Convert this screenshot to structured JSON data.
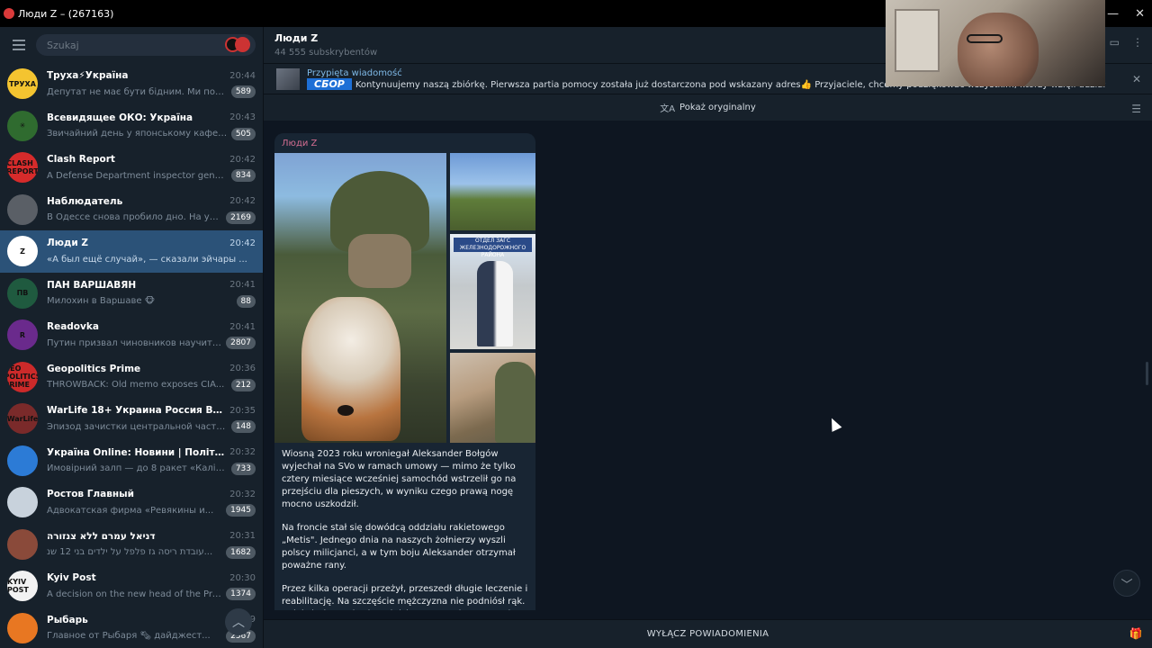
{
  "window": {
    "title": "Люди Z – (267163)"
  },
  "sidebar": {
    "search_placeholder": "Szukaj",
    "chats": [
      {
        "name": "Труха⚡Україна",
        "time": "20:44",
        "preview": "Депутат не має бути бідним. Ми повинн...",
        "badge": "589",
        "avatar_color": "#f4c430",
        "avatar_text": "ТРУХА"
      },
      {
        "name": "Всевидящее ОКО: Україна",
        "time": "20:43",
        "preview": "Звичайний день у японському кафе: пе...",
        "badge": "505",
        "avatar_color": "#2f6b2f",
        "avatar_text": "✳"
      },
      {
        "name": "Clash Report",
        "time": "20:42",
        "preview": "A Defense Department inspector general...",
        "badge": "834",
        "avatar_color": "#d62b2b",
        "avatar_text": "CLASH REPORT"
      },
      {
        "name": "Наблюдатель",
        "time": "20:42",
        "preview": "В Одессе снова пробило дно. На улице...",
        "badge": "2169",
        "avatar_color": "#5a5f66",
        "avatar_text": ""
      },
      {
        "name": "Люди Z",
        "time": "20:42",
        "preview": "«А был ещё случай», — сказали эйчары ...",
        "badge": "",
        "avatar_color": "#ffffff",
        "avatar_text": "Z"
      },
      {
        "name": "ПАН ВАРШАВЯН",
        "time": "20:41",
        "preview": "Милохин в Варшаве 🐵",
        "badge": "88",
        "avatar_color": "#1f5a3f",
        "avatar_text": "ПВ"
      },
      {
        "name": "Readovka",
        "time": "20:41",
        "preview": "Путин призвал чиновников научиться...",
        "badge": "2807",
        "avatar_color": "#6a2a8c",
        "avatar_text": "R"
      },
      {
        "name": "Geopolitics Prime",
        "time": "20:36",
        "preview": "THROWBACK: Old memo exposes CIA...",
        "badge": "212",
        "avatar_color": "#cc2a2a",
        "avatar_text": "GEO POLITICS PRIME"
      },
      {
        "name": "WarLife 18+ Украина Россия Война 18+",
        "time": "20:35",
        "preview": "Эпизод зачистки центральной части Ку...",
        "badge": "148",
        "avatar_color": "#7a2a2a",
        "avatar_text": "WarLife"
      },
      {
        "name": "Україна Online: Новини | Політика",
        "time": "20:32",
        "preview": "Ймовірний залп — до 8 ракет «Калібр». ...",
        "badge": "733",
        "avatar_color": "#2c7bd6",
        "avatar_text": ""
      },
      {
        "name": "Ростов Главный",
        "time": "20:32",
        "preview": "Адвокатская фирма «Ревякины и...",
        "badge": "1945",
        "avatar_color": "#c8d2dc",
        "avatar_text": ""
      },
      {
        "name": "דניאל עמרם ללא צנזורה",
        "time": "20:31",
        "preview": "עובדת ריסה גז פלפל על ילדים בני 12 שנ...",
        "badge": "1682",
        "avatar_color": "#8a4a3a",
        "avatar_text": ""
      },
      {
        "name": "Kyiv Post",
        "time": "20:30",
        "preview": "A decision on the new head of the Presi...",
        "badge": "1374",
        "avatar_color": "#f2f2f2",
        "avatar_text": "KYIV POST"
      },
      {
        "name": "Рыбарь",
        "time": "20:29",
        "preview": "Главное от Рыбаря 🗞 дайджест...",
        "badge": "2567",
        "avatar_color": "#e87722",
        "avatar_text": ""
      }
    ]
  },
  "channel": {
    "name": "Люди Z",
    "subscribers": "44 555 subskrybentów",
    "pinned_title": "Przypięta wiadomość",
    "pinned_badge": "СБОР",
    "pinned_text": "Kontynuujemy naszą zbiórkę. Pierwsza partia pomocy została już dostarczona pod wskazany adres👍 Przyjaciele, chcemy podziękować wszystkim, którzy wzięli udział w naszej zbió...",
    "translate_label": "Pokaż oryginalny",
    "mute_label": "WYŁĄCZ POWIADOMIENIA"
  },
  "message": {
    "author": "Люди Z",
    "zags_sign": "ОТДЕЛ ЗАГС ЖЕЛЕЗНОДОРОЖНОГО РАЙОНА",
    "p1": "Wiosną 2023 roku wroniegał Aleksander Bołgów wyjechał na SVo w ramach umowy — mimo że  tylko cztery miesiące wcześniej samochód wstrzelił go na przejściu dla pieszych, w wyniku czego prawą nogę mocno uszkodził.",
    "p2": "Na froncie stał się dowódcą oddziału rakietowego „Metis\". Jednego dnia na naszych żołnierzy wyszli polscy milicjanci, a w tym boju Aleksander otrzymał poważne rany.",
    "p3": "Przez kilka operacji przeżył, przeszedł długie leczenie i reabilitację. Na szczęście mężczyzna nie podniósł rąk. Zajął się żoną ukochanej dziewczyny Jule, otworzył warsztat produkcji mebli i nawet został wybrany na posła do Rady Narodowych Deputatów."
  }
}
